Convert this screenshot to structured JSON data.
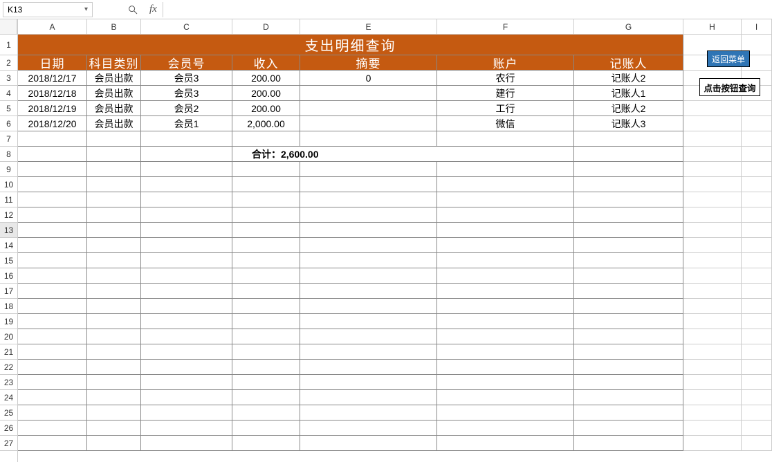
{
  "nameBox": "K13",
  "fx": "fx",
  "formulaInput": "",
  "columns": [
    "A",
    "B",
    "C",
    "D",
    "E",
    "F",
    "G",
    "H",
    "I"
  ],
  "rows": [
    "1",
    "2",
    "3",
    "4",
    "5",
    "6",
    "7",
    "8",
    "9",
    "10",
    "11",
    "12",
    "13",
    "14",
    "15",
    "16",
    "17",
    "18",
    "19",
    "20",
    "21",
    "22",
    "23",
    "24",
    "25",
    "26",
    "27"
  ],
  "title": "支出明细查询",
  "headers": {
    "date": "日期",
    "category": "科目类别",
    "member": "会员号",
    "income": "收入",
    "summary": "摘要",
    "account": "账户",
    "accountant": "记账人"
  },
  "records": [
    {
      "date": "2018/12/17",
      "category": "会员出款",
      "member": "会员3",
      "income": "200.00",
      "summary": "0",
      "account": "农行",
      "accountant": "记账人2"
    },
    {
      "date": "2018/12/18",
      "category": "会员出款",
      "member": "会员3",
      "income": "200.00",
      "summary": "",
      "account": "建行",
      "accountant": "记账人1"
    },
    {
      "date": "2018/12/19",
      "category": "会员出款",
      "member": "会员2",
      "income": "200.00",
      "summary": "",
      "account": "工行",
      "accountant": "记账人2"
    },
    {
      "date": "2018/12/20",
      "category": "会员出款",
      "member": "会员1",
      "income": "2,000.00",
      "summary": "",
      "account": "微信",
      "accountant": "记账人3"
    }
  ],
  "totalLabel": "合计：2,600.00",
  "buttons": {
    "back": "返回菜单",
    "query": "点击按钮查询"
  },
  "activeCell": "K13",
  "chart_data": {
    "type": "table",
    "title": "支出明细查询",
    "columns": [
      "日期",
      "科目类别",
      "会员号",
      "收入",
      "摘要",
      "账户",
      "记账人"
    ],
    "rows": [
      [
        "2018/12/17",
        "会员出款",
        "会员3",
        200.0,
        "0",
        "农行",
        "记账人2"
      ],
      [
        "2018/12/18",
        "会员出款",
        "会员3",
        200.0,
        "",
        "建行",
        "记账人1"
      ],
      [
        "2018/12/19",
        "会员出款",
        "会员2",
        200.0,
        "",
        "工行",
        "记账人2"
      ],
      [
        "2018/12/20",
        "会员出款",
        "会员1",
        2000.0,
        "",
        "微信",
        "记账人3"
      ]
    ],
    "total": 2600.0
  }
}
